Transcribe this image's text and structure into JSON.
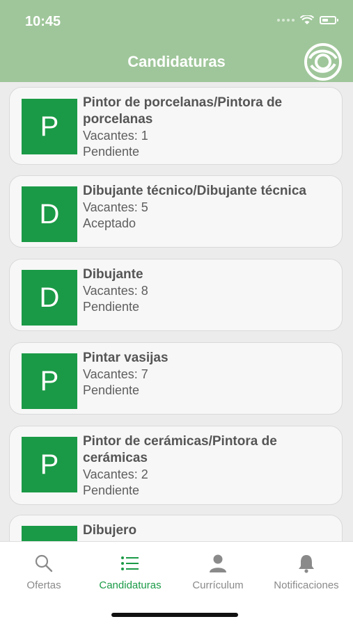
{
  "status": {
    "time": "10:45"
  },
  "header": {
    "title": "Candidaturas",
    "logo_icon": "company-logo-icon"
  },
  "cards": [
    {
      "initial": "P",
      "title_line1": "Pintor de porcelanas/Pintora de",
      "title_line2": "porcelanas",
      "vacancies": "Vacantes: 1",
      "status": "Pendiente"
    },
    {
      "initial": "D",
      "title_line1": "Dibujante técnico/Dibujante técnica",
      "vacancies": "Vacantes: 5",
      "status": "Aceptado"
    },
    {
      "initial": "D",
      "title_line1": "Dibujante",
      "vacancies": "Vacantes: 8",
      "status": "Pendiente"
    },
    {
      "initial": "P",
      "title_line1": "Pintar vasijas",
      "vacancies": "Vacantes: 7",
      "status": "Pendiente"
    },
    {
      "initial": "P",
      "title_line1": "Pintor de cerámicas/Pintora de",
      "title_line2": "cerámicas",
      "vacancies": "Vacantes: 2",
      "status": "Pendiente"
    },
    {
      "initial": "",
      "title_line1": "Dibujero",
      "vacancies": "",
      "status": ""
    }
  ],
  "tabs": [
    {
      "label": "Ofertas",
      "icon": "search-icon"
    },
    {
      "label": "Candidaturas",
      "icon": "list-icon",
      "active": true
    },
    {
      "label": "Currículum",
      "icon": "person-icon"
    },
    {
      "label": "Notificaciones",
      "icon": "bell-icon"
    }
  ],
  "colors": {
    "header": "#9fc69a",
    "accent": "#1a9a46",
    "background": "#ececec"
  }
}
